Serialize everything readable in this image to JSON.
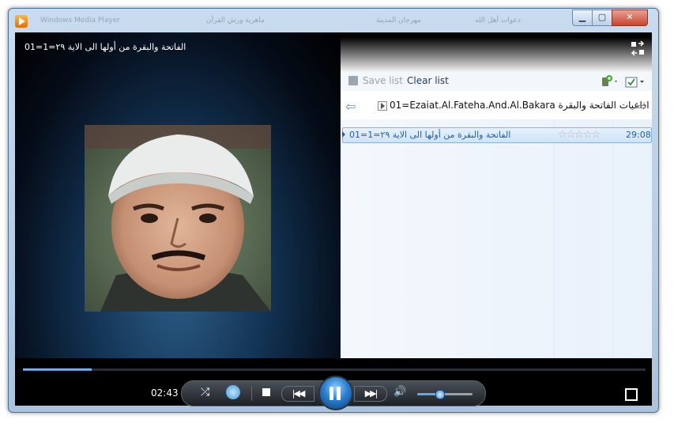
{
  "window": {
    "background_titles": [
      "Windows Media Player",
      "ماهرية ورش القرآن",
      "مهرجان المدينة",
      "دعوات أهل الله"
    ]
  },
  "video": {
    "title": "الفاتحة والبقرة من أولها الى الاية ٢٩=1=01"
  },
  "playlist_toolbar": {
    "save_label": "Save list",
    "clear_label": "Clear list"
  },
  "playlist_nav": {
    "title": "01=Ezaiat.Al.Fateha.And.Al.Bakara اذاعيات الفاتحة والبقرة"
  },
  "playlist": {
    "items": [
      {
        "title": "الفاتحة والبقرة من أولها الى الاية ٢٩=1=01",
        "rating": 0,
        "rating_stars": "☆☆☆☆☆",
        "duration": "29:08"
      }
    ]
  },
  "controls": {
    "elapsed": "02:43",
    "seek_fraction": 0.11,
    "volume_fraction": 0.4
  },
  "colors": {
    "accent": "#3f82c7",
    "playlist_text": "#1f5fa8"
  },
  "icons": {
    "switch_view": "switch-to-library-icon",
    "sync": "sync-device-icon",
    "list_options": "list-options-icon",
    "fullscreen": "fullscreen-icon"
  }
}
